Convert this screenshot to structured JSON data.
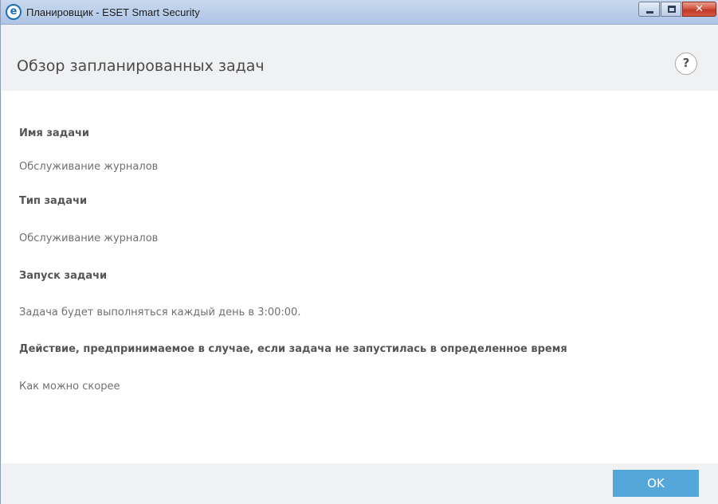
{
  "window": {
    "title": "Планировщик - ESET Smart Security",
    "logo_letter": "e",
    "buttons": {
      "minimize_icon": "minimize-icon",
      "maximize_icon": "maximize-icon",
      "close_icon": "close-icon",
      "close_glyph": "✕"
    }
  },
  "header": {
    "title": "Обзор запланированных задач",
    "help_glyph": "?"
  },
  "details": {
    "task_name_label": "Имя задачи",
    "task_name_value": "Обслуживание журналов",
    "task_type_label": "Тип задачи",
    "task_type_value": "Обслуживание журналов",
    "task_run_label": "Запуск задачи",
    "task_run_value": "Задача будет выполняться каждый день в 3:00:00.",
    "missed_action_label": "Действие, предпринимаемое в случае, если задача не запустилась в определенное время",
    "missed_action_value": "Как можно скорее"
  },
  "footer": {
    "ok_label": "OK"
  },
  "colors": {
    "accent": "#55a7d9",
    "brand": "#1c6fb7",
    "close_button": "#c0392b"
  }
}
